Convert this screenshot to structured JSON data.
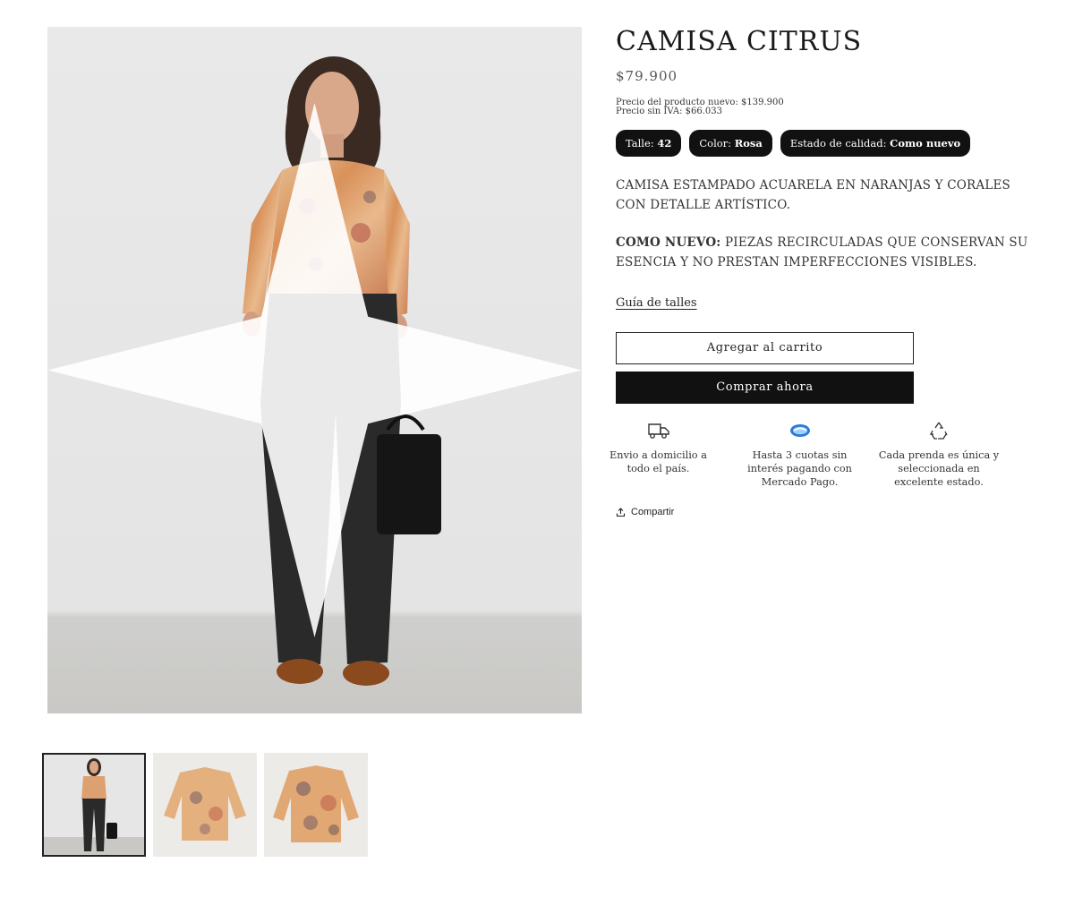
{
  "product": {
    "title": "CAMISA CITRUS",
    "price": "$79.900",
    "new_price_line": "Precio del producto nuevo: $139.900",
    "no_tax_line": "Precio sin IVA: $66.033",
    "chips": [
      {
        "label": "Talle:",
        "value": "42"
      },
      {
        "label": "Color:",
        "value": "Rosa"
      },
      {
        "label": "Estado de calidad:",
        "value": "Como nuevo"
      }
    ],
    "description": "CAMISA ESTAMPADO ACUARELA EN NARANJAS Y CORALES CON DETALLE ARTÍSTICO.",
    "quality_label": "COMO NUEVO:",
    "quality_text": "PIEZAS RECIRCULADAS QUE CONSERVAN SU ESENCIA Y NO PRESTAN IMPERFECCIONES VISIBLES.",
    "size_guide": "Guía de talles"
  },
  "actions": {
    "add_to_cart": "Agregar al carrito",
    "buy_now": "Comprar ahora",
    "share": "Compartir"
  },
  "features": [
    {
      "icon": "truck-icon",
      "text": "Envio a domicilio a todo el país."
    },
    {
      "icon": "mercado-pago-icon",
      "text": "Hasta 3 cuotas sin interés pagando con Mercado Pago."
    },
    {
      "icon": "recycle-icon",
      "text": "Cada prenda es única y seleccionada en excelente estado."
    }
  ],
  "gallery": {
    "thumbnails": [
      "model-full-body",
      "shirt-front",
      "shirt-back"
    ],
    "active_index": 0
  },
  "colors": {
    "text": "#222222",
    "chip_bg": "#111111",
    "buy_button_bg": "#111111",
    "mercado_pago_blue": "#2d7ad6"
  }
}
